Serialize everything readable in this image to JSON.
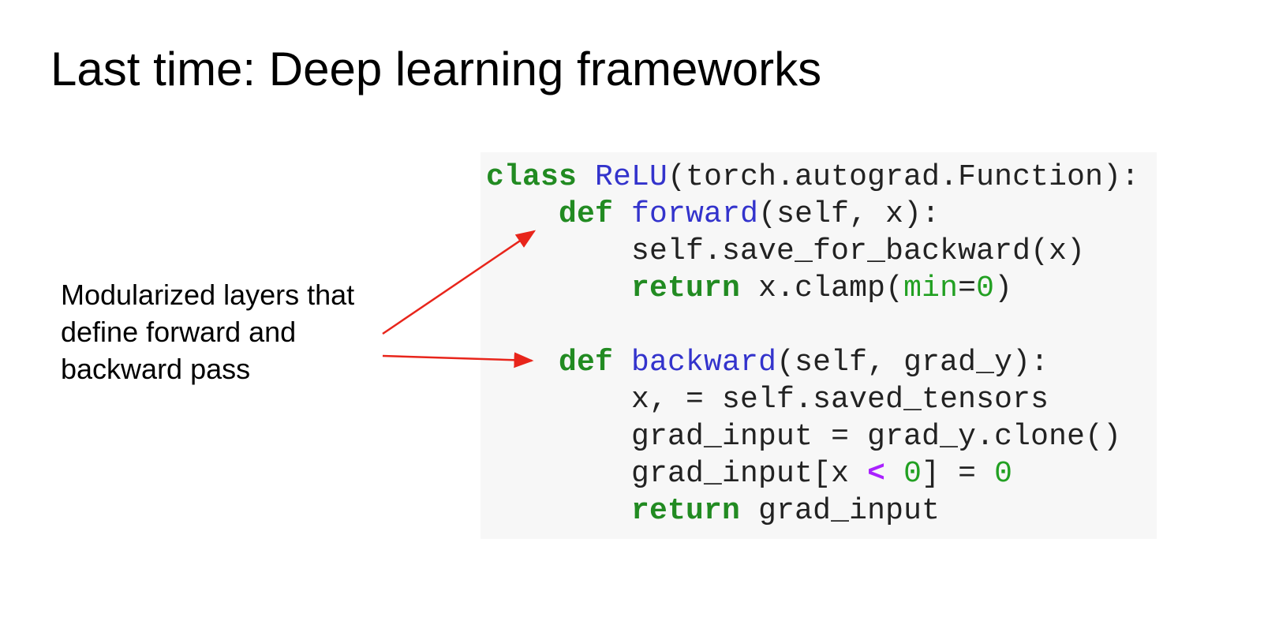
{
  "slide": {
    "title": "Last time: Deep learning frameworks"
  },
  "annotation": {
    "lines": [
      "Modularized layers that",
      "define forward and",
      "backward pass"
    ]
  },
  "code": {
    "line1": {
      "kw": "class",
      "name": "ReLU",
      "rest": "(torch.autograd.Function):"
    },
    "line2": {
      "indent": "    ",
      "kw": "def",
      "name": "forward",
      "rest": "(self, x):"
    },
    "line3": {
      "indent": "        ",
      "text": "self.save_for_backward(x)"
    },
    "line4": {
      "indent": "        ",
      "kw": "return",
      "pre": " x.clamp(",
      "param": "min",
      "eq": "=",
      "num": "0",
      "post": ")"
    },
    "line5": {
      "text": ""
    },
    "line6": {
      "indent": "    ",
      "kw": "def",
      "name": "backward",
      "rest": "(self, grad_y):"
    },
    "line7": {
      "indent": "        ",
      "text": "x, = self.saved_tensors"
    },
    "line8": {
      "indent": "        ",
      "text": "grad_input = grad_y.clone()"
    },
    "line9": {
      "indent": "        ",
      "pre": "grad_input[x ",
      "op": "<",
      "sp": " ",
      "num": "0",
      "post": "] = ",
      "num2": "0"
    },
    "line10": {
      "indent": "        ",
      "kw": "return",
      "rest": " grad_input"
    }
  },
  "colors": {
    "keyword": "#228b22",
    "function_name": "#3333cc",
    "number": "#22a022",
    "operator": "#aa22ff",
    "arrow": "#e8251b",
    "code_background": "#f7f7f7"
  }
}
